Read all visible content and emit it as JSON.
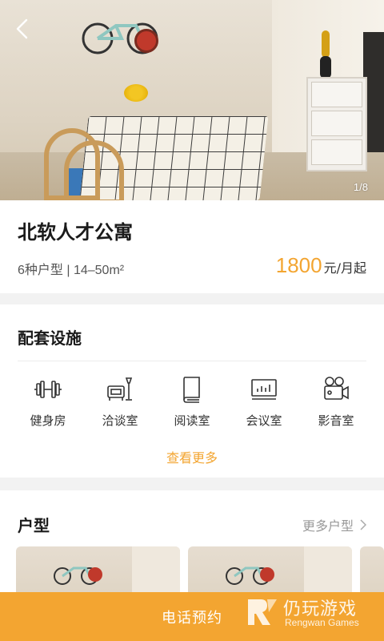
{
  "hero": {
    "image_counter": "1/8"
  },
  "listing": {
    "title": "北软人才公寓",
    "meta": "6种户型 | 14–50m²",
    "price": "1800",
    "price_unit": "元/月起"
  },
  "facilities": {
    "title": "配套设施",
    "items": [
      {
        "label": "健身房",
        "icon": "dumbbell-icon"
      },
      {
        "label": "洽谈室",
        "icon": "sofa-lamp-icon"
      },
      {
        "label": "阅读室",
        "icon": "book-icon"
      },
      {
        "label": "会议室",
        "icon": "presentation-board-icon"
      },
      {
        "label": "影音室",
        "icon": "movie-camera-icon"
      }
    ],
    "more_label": "查看更多"
  },
  "room_types": {
    "title": "户型",
    "more_label": "更多户型"
  },
  "bottom_bar": {
    "call_label": "电话预约"
  },
  "watermark": {
    "cn": "仍玩游戏",
    "en": "Rengwan Games"
  },
  "colors": {
    "accent": "#f3a531",
    "background": "#f2f2f2"
  }
}
